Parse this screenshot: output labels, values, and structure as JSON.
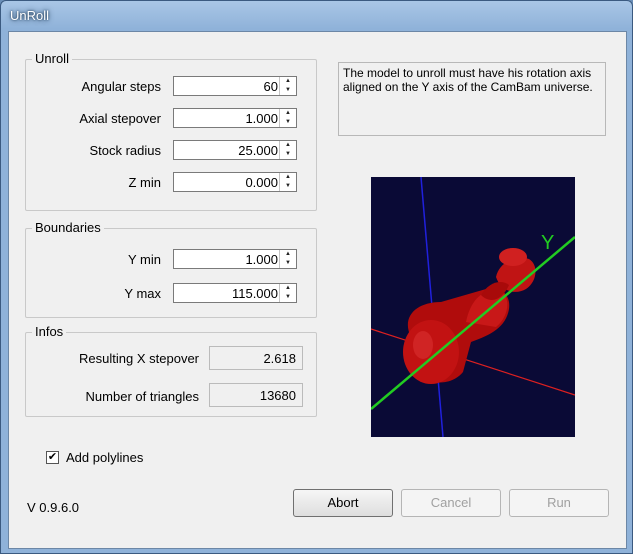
{
  "window": {
    "title": "UnRoll"
  },
  "unroll": {
    "title": "Unroll",
    "angular_steps_label": "Angular steps",
    "angular_steps_value": "60",
    "axial_stepover_label": "Axial stepover",
    "axial_stepover_value": "1.000",
    "stock_radius_label": "Stock radius",
    "stock_radius_value": "25.000",
    "zmin_label": "Z min",
    "zmin_value": "0.000"
  },
  "boundaries": {
    "title": "Boundaries",
    "ymin_label": "Y min",
    "ymin_value": "1.000",
    "ymax_label": "Y max",
    "ymax_value": "115.000"
  },
  "infos": {
    "title": "Infos",
    "x_stepover_label": "Resulting X stepover",
    "x_stepover_value": "2.618",
    "triangles_label": "Number of triangles",
    "triangles_value": "13680"
  },
  "info_text": "The model to unroll must have his rotation axis aligned on the Y axis of the CamBam universe.",
  "viewport": {
    "axis_label": "Y",
    "colors": {
      "y_axis": "#22cc22",
      "x_axis": "#dd2020",
      "z_axis": "#2020dd",
      "model": "#c01010",
      "background": "#0a0a36"
    }
  },
  "add_polylines": {
    "label": "Add polylines",
    "checked": true
  },
  "version": "V 0.9.6.0",
  "buttons": {
    "abort": "Abort",
    "cancel": "Cancel",
    "run": "Run"
  }
}
